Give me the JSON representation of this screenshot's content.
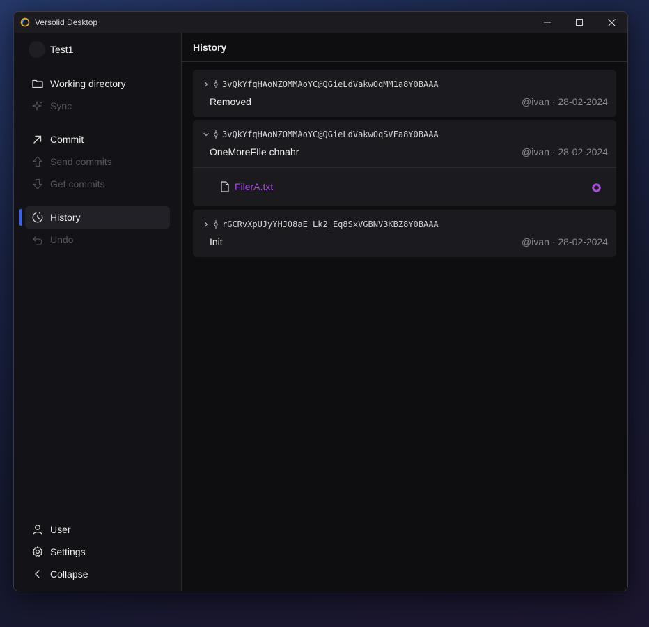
{
  "window": {
    "title": "Versolid Desktop"
  },
  "sidebar": {
    "account_name": "Test1",
    "items": [
      {
        "label": "Working directory",
        "icon": "folder-icon",
        "enabled": true
      },
      {
        "label": "Sync",
        "icon": "sparkle-icon",
        "enabled": false
      },
      {
        "label": "Commit",
        "icon": "arrow-up-right-icon",
        "enabled": true
      },
      {
        "label": "Send commits",
        "icon": "arrow-up-outline-icon",
        "enabled": false
      },
      {
        "label": "Get commits",
        "icon": "arrow-down-outline-icon",
        "enabled": false
      },
      {
        "label": "History",
        "icon": "history-icon",
        "enabled": true,
        "active": true
      },
      {
        "label": "Undo",
        "icon": "undo-icon",
        "enabled": false
      }
    ],
    "bottom_items": [
      {
        "label": "User",
        "icon": "user-icon"
      },
      {
        "label": "Settings",
        "icon": "gear-icon"
      },
      {
        "label": "Collapse",
        "icon": "chevron-left-icon"
      }
    ]
  },
  "main": {
    "title": "History",
    "commits": [
      {
        "id": "3vQkYfqHAoNZOMMAoYC@QGieLdVakwOqMM1a8Y0BAAA",
        "message": "Removed",
        "meta": "@ivan · 28-02-2024",
        "expanded": false
      },
      {
        "id": "3vQkYfqHAoNZOMMAoYC@QGieLdVakwOqSVFa8Y0BAAA",
        "message": "OneMoreFIle chnahr",
        "meta": "@ivan · 28-02-2024",
        "expanded": true,
        "files": [
          {
            "name": "FilerA.txt",
            "status_color": "#a44ddb"
          }
        ]
      },
      {
        "id": "rGCRvXpUJyYHJ08aE_Lk2_Eq8SxVGBNV3KBZ8Y0BAAA",
        "message": "Init",
        "meta": "@ivan · 28-02-2024",
        "expanded": false
      }
    ]
  },
  "colors": {
    "accent": "#3b62e6",
    "file_modified": "#a44ddb"
  }
}
